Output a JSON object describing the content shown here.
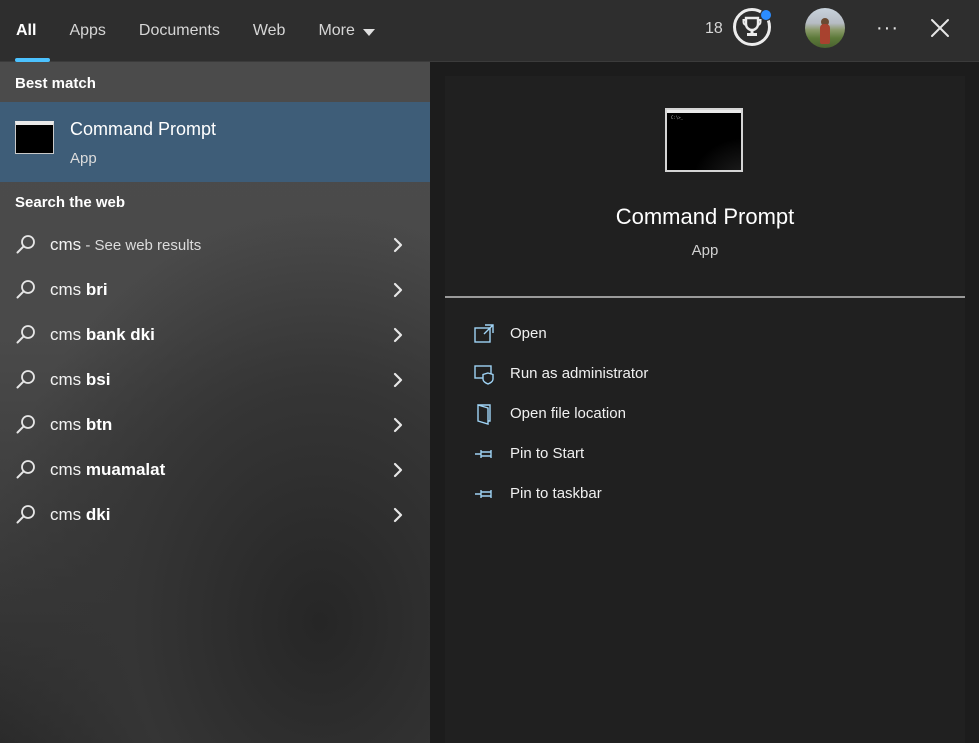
{
  "tabs": [
    {
      "label": "All",
      "active": true
    },
    {
      "label": "Apps",
      "active": false
    },
    {
      "label": "Documents",
      "active": false
    },
    {
      "label": "Web",
      "active": false
    },
    {
      "label": "More",
      "active": false
    }
  ],
  "header": {
    "points": "18",
    "trophy_icon": "trophy-icon",
    "more_icon": "ellipsis-icon",
    "close_icon": "close-icon",
    "more_glyph": "···"
  },
  "left": {
    "best_match_heading": "Best match",
    "best_match": {
      "title": "Command Prompt",
      "subtitle": "App"
    },
    "web_heading": "Search the web",
    "web_results": [
      {
        "prefix": "cms",
        "bold": "",
        "suffix": " - See web results"
      },
      {
        "prefix": "cms ",
        "bold": "bri",
        "suffix": ""
      },
      {
        "prefix": "cms ",
        "bold": "bank dki",
        "suffix": ""
      },
      {
        "prefix": "cms ",
        "bold": "bsi",
        "suffix": ""
      },
      {
        "prefix": "cms ",
        "bold": "btn",
        "suffix": ""
      },
      {
        "prefix": "cms ",
        "bold": "muamalat",
        "suffix": ""
      },
      {
        "prefix": "cms ",
        "bold": "dki",
        "suffix": ""
      }
    ]
  },
  "right": {
    "title": "Command Prompt",
    "subtitle": "App",
    "actions": [
      {
        "label": "Open",
        "icon": "open-icon"
      },
      {
        "label": "Run as administrator",
        "icon": "shield-icon"
      },
      {
        "label": "Open file location",
        "icon": "folder-icon"
      },
      {
        "label": "Pin to Start",
        "icon": "pin-icon"
      },
      {
        "label": "Pin to taskbar",
        "icon": "pin-icon"
      }
    ]
  },
  "colors": {
    "accent": "#4cc2ff",
    "selection": "#3e5d78",
    "icon_blue": "#9fd3f5",
    "notification": "#2b8cff"
  }
}
